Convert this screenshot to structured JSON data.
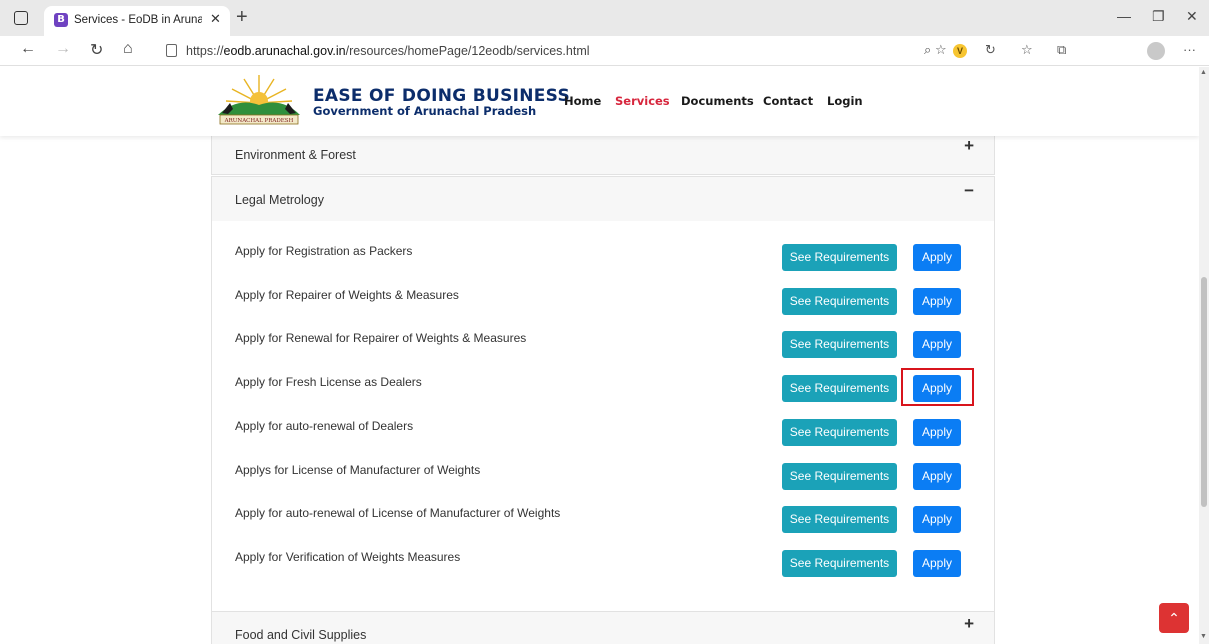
{
  "browser": {
    "tab_title": "Services - EoDB in Arunachal Pra",
    "tab_favicon": "B",
    "url_prefix": "https://",
    "url_host": "eodb.arunachal.gov.in",
    "url_path": "/resources/homePage/12eodb/services.html",
    "icons": [
      "back-icon",
      "forward-icon",
      "refresh-icon",
      "home-icon",
      "lock-icon",
      "zoom-icon",
      "favorite-icon",
      "extension-icon",
      "refresh-extension-icon",
      "favorites-icon",
      "collections-icon",
      "profile-icon",
      "more-icon"
    ]
  },
  "header": {
    "logo_text": "ARUNACHAL PRADESH",
    "title": "EASE OF DOING BUSINESS",
    "subtitle": "Government of Arunachal Pradesh",
    "nav": [
      "Home",
      "Services",
      "Documents",
      "Contact",
      "Login"
    ],
    "active_nav": "Services"
  },
  "sections": {
    "env": {
      "title": "Environment & Forest",
      "toggle": "+"
    },
    "legal": {
      "title": "Legal Metrology",
      "toggle": "−",
      "services": [
        "Apply for Registration as Packers",
        "Apply for Repairer of Weights & Measures",
        "Apply for Renewal for Repairer of Weights & Measures",
        "Apply for Fresh License as Dealers",
        "Apply for auto-renewal of Dealers",
        "Applys for License of Manufacturer of Weights",
        "Apply for auto-renewal of License of Manufacturer of Weights",
        "Apply for Verification of Weights Measures"
      ],
      "req_label": "See Requirements",
      "apply_label": "Apply",
      "highlighted_row": 3
    },
    "food": {
      "title": "Food and Civil Supplies",
      "toggle": "+"
    }
  },
  "colors": {
    "req_button": "#1ba2b8",
    "apply_button": "#0b7df4",
    "active_nav": "#d7263d",
    "highlight": "#d8141c",
    "brand": "#0c2d6b"
  }
}
